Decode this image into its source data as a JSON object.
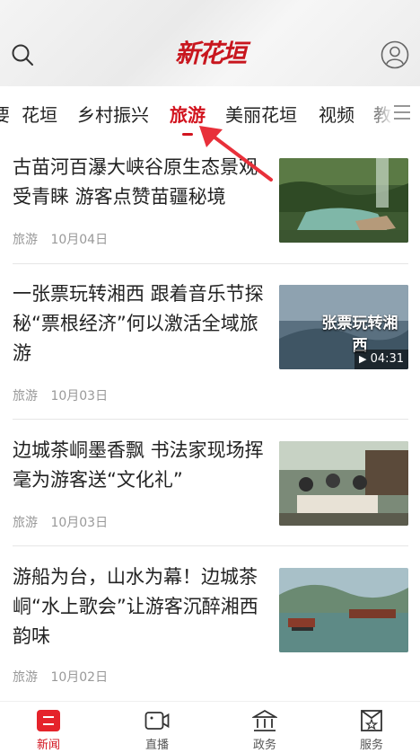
{
  "header": {
    "logo_text": "新花垣",
    "search_icon": "search-icon",
    "user_icon": "user-icon"
  },
  "tabs": [
    {
      "label": "要"
    },
    {
      "label": "花垣"
    },
    {
      "label": "乡村振兴"
    },
    {
      "label": "旅游",
      "active": true
    },
    {
      "label": "美丽花垣"
    },
    {
      "label": "视频"
    },
    {
      "label": "教"
    }
  ],
  "colors": {
    "accent": "#d2141f",
    "meta": "#999999"
  },
  "news": [
    {
      "title": "古苗河百瀑大峡谷原生态景观受青睐 游客点赞苗疆秘境",
      "category": "旅游",
      "date": "10月04日"
    },
    {
      "title": "一张票玩转湘西 跟着音乐节探秘“票根经济”何以激活全域旅游",
      "category": "旅游",
      "date": "10月03日",
      "video_duration": "04:31",
      "thumb_caption": "张票玩转湘西"
    },
    {
      "title": "边城茶峒墨香飘 书法家现场挥毫为游客送“文化礼”",
      "category": "旅游",
      "date": "10月03日"
    },
    {
      "title": "游船为台，山水为幕！边城茶峒“水上歌会”让游客沉醉湘西韵味",
      "category": "旅游",
      "date": "10月02日"
    }
  ],
  "bottom_nav": [
    {
      "label": "新闻",
      "icon": "news-icon",
      "active": true
    },
    {
      "label": "直播",
      "icon": "camera-icon"
    },
    {
      "label": "政务",
      "icon": "government-icon"
    },
    {
      "label": "服务",
      "icon": "service-icon"
    }
  ]
}
